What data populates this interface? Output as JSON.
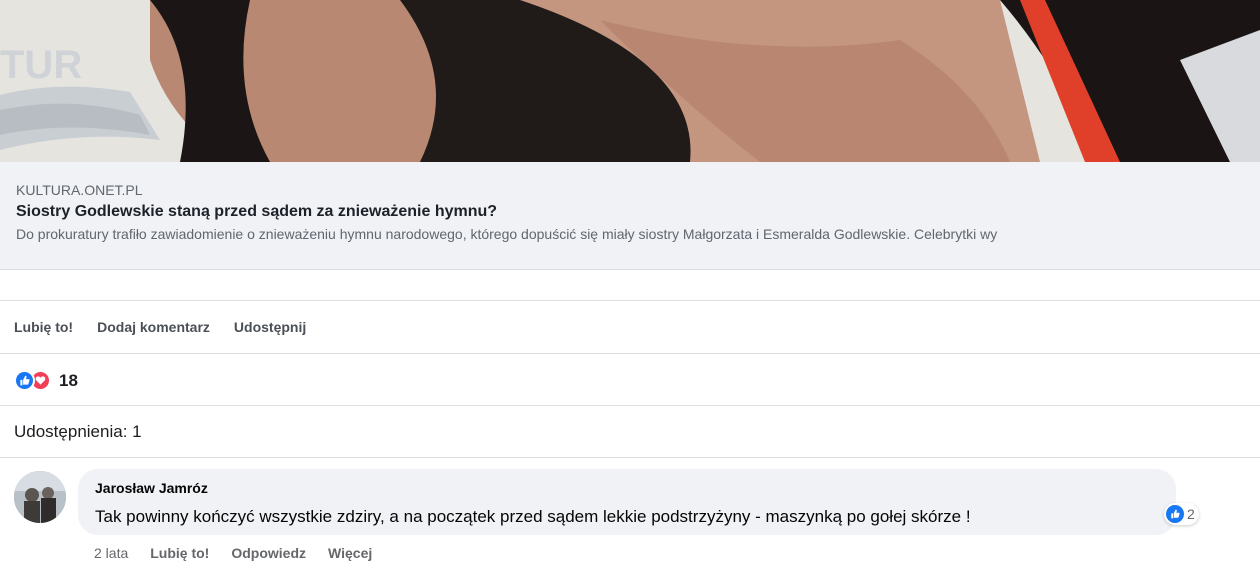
{
  "photo": {
    "watermark_text": "TUR"
  },
  "link_preview": {
    "domain": "KULTURA.ONET.PL",
    "title": "Siostry Godlewskie staną przed sądem za znieważenie hymnu?",
    "description": "Do prokuratury trafiło zawiadomienie o znieważeniu hymnu narodowego, którego dopuścić się miały siostry Małgorzata i Esmeralda Godlewskie. Celebrytki wy"
  },
  "actions": {
    "like": "Lubię to!",
    "comment": "Dodaj komentarz",
    "share": "Udostępnij"
  },
  "reactions": {
    "icons": [
      "like-icon",
      "love-icon"
    ],
    "count": "18"
  },
  "shares": {
    "label": "Udostępnienia: 1"
  },
  "comment": {
    "author": "Jarosław Jamróz",
    "text": "Tak powinny kończyć wszystkie zdziry, a na początek przed sądem lekkie podstrzyżyny - maszynką po gołej skórze !",
    "like_count": "2",
    "time": "2 lata",
    "like_label": "Lubię to!",
    "reply_label": "Odpowiedz",
    "more_label": "Więcej"
  },
  "colors": {
    "like_blue": "#1877f2",
    "love_red": "#f33e58",
    "preview_bg": "#f0f2f5"
  }
}
